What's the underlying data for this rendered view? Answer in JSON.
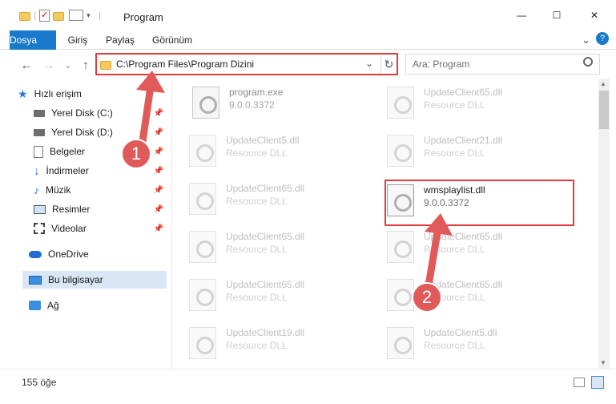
{
  "window": {
    "title": "Program",
    "controls": {
      "minimize": "—",
      "maximize": "☐",
      "close": "✕"
    }
  },
  "ribbon": {
    "tabs": [
      "Dosya",
      "Giriş",
      "Paylaş",
      "Görünüm"
    ],
    "collapse": "⌄",
    "help": "?"
  },
  "nav": {
    "back": "←",
    "forward": "→",
    "recent": "⌄",
    "up": "↑",
    "address": "C:\\Program Files\\Program Dizini",
    "dropdown": "⌄",
    "refresh": "↻",
    "search_placeholder": "Ara: Program"
  },
  "sidebar": {
    "items": [
      {
        "label": "Hızlı erişim",
        "icon": "star-icon"
      },
      {
        "label": "Yerel Disk (C:)",
        "icon": "drive-icon",
        "pin": "📌"
      },
      {
        "label": "Yerel Disk (D:)",
        "icon": "drive-icon",
        "pin": "📌"
      },
      {
        "label": "Belgeler",
        "icon": "documents-icon",
        "pin": "📌"
      },
      {
        "label": "İndirmeler",
        "icon": "download-icon",
        "pin": "📌"
      },
      {
        "label": "Müzik",
        "icon": "music-icon",
        "pin": "📌"
      },
      {
        "label": "Resimler",
        "icon": "pictures-icon",
        "pin": "📌"
      },
      {
        "label": "Videolar",
        "icon": "videos-icon",
        "pin": "📌"
      },
      {
        "label": "OneDrive",
        "icon": "cloud-icon"
      },
      {
        "label": "Bu bilgisayar",
        "icon": "computer-icon"
      },
      {
        "label": "Ağ",
        "icon": "network-icon"
      }
    ]
  },
  "files": {
    "left": [
      {
        "name": "program.exe",
        "sub": "9.0.0.3372"
      },
      {
        "name": "UpdateClient5.dll",
        "sub": "Resource DLL"
      },
      {
        "name": "UpdateClient65.dll",
        "sub": "Resource DLL"
      },
      {
        "name": "UpdateClient65.dll",
        "sub": "Resource DLL"
      },
      {
        "name": "UpdateClient65.dll",
        "sub": "Resource DLL"
      },
      {
        "name": "UpdateClient19.dll",
        "sub": "Resource DLL"
      }
    ],
    "right": [
      {
        "name": "UpdateClient65.dll",
        "sub": "Resource DLL"
      },
      {
        "name": "UpdateClient21.dll",
        "sub": "Resource DLL"
      },
      {
        "name": "wmsplaylist.dll",
        "sub": "9.0.0.3372"
      },
      {
        "name": "UpdateClient65.dll",
        "sub": "Resource DLL"
      },
      {
        "name": "UpdateClient65.dll",
        "sub": "Resource DLL"
      },
      {
        "name": "UpdateClient5.dll",
        "sub": "Resource DLL"
      }
    ]
  },
  "annotations": {
    "step1": "1",
    "step2": "2",
    "color": "#e15a5a"
  },
  "status": {
    "count": "155 öğe"
  }
}
